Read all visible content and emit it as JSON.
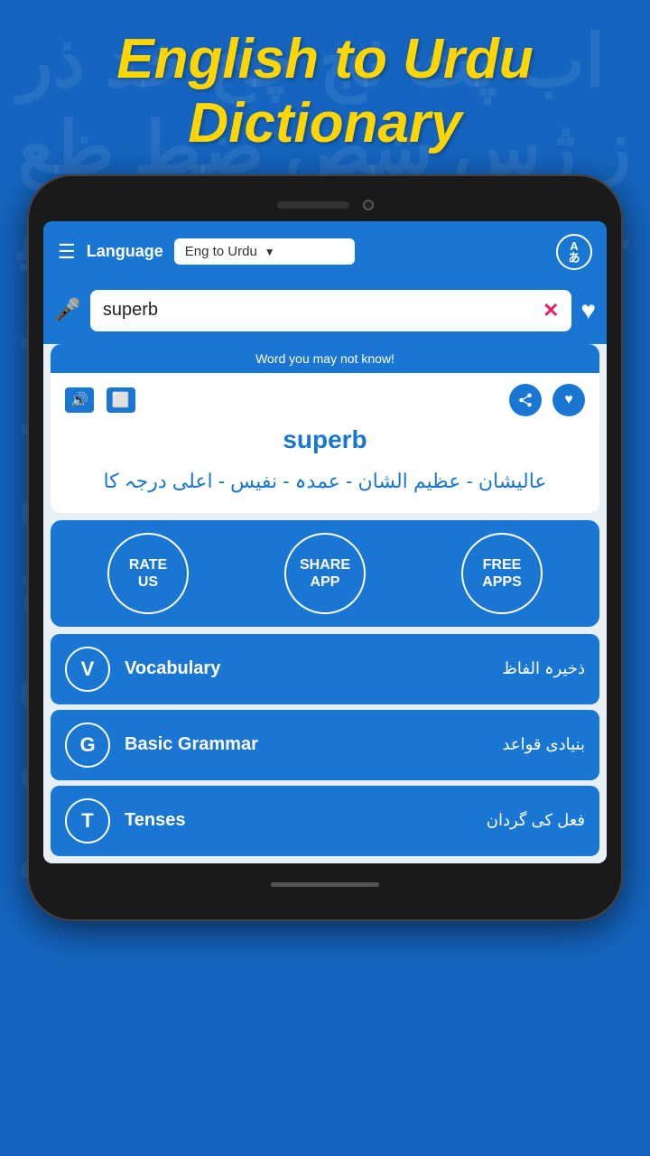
{
  "page": {
    "bg_letters": "اب پت ثج چح خد ذر ز ژس شص ضط ظع غف قک گل م ن وه یے",
    "header_title_line1": "English to Urdu",
    "header_title_line2": "Dictionary"
  },
  "topbar": {
    "language_label": "Language",
    "dropdown_text": "Eng to Urdu",
    "translate_icon_text": "A\nあ"
  },
  "search": {
    "value": "superb",
    "mic_icon": "🎤",
    "clear_icon": "✕"
  },
  "word_card": {
    "banner": "Word you may not know!",
    "word": "superb",
    "translation": "عالیشان - عظیم الشان - عمدہ - نفیس - اعلی درجہ کا"
  },
  "buttons": [
    {
      "label": "RATE\nUS"
    },
    {
      "label": "SHARE\nAPP"
    },
    {
      "label": "FREE\nAPPS"
    }
  ],
  "menu_items": [
    {
      "icon": "V",
      "label": "Vocabulary",
      "urdu": "ذخیرہ الفاظ"
    },
    {
      "icon": "G",
      "label": "Basic Grammar",
      "urdu": "بنیادی قواعد"
    },
    {
      "icon": "T",
      "label": "Tenses",
      "urdu": "فعل کی گردان"
    }
  ]
}
